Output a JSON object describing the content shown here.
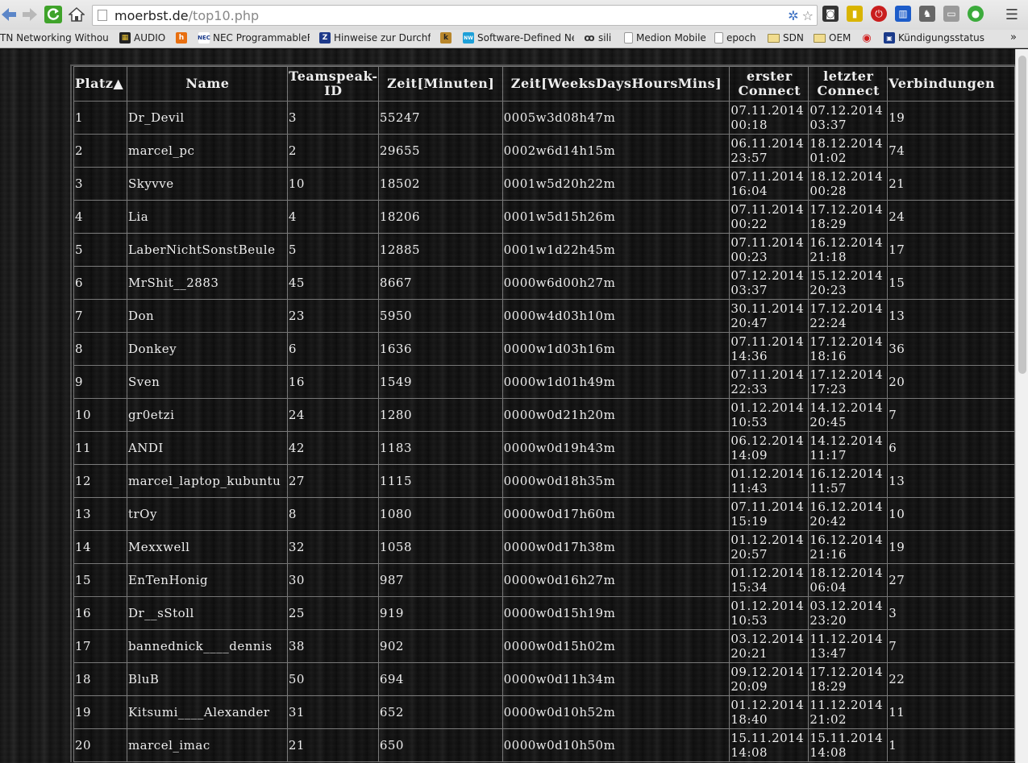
{
  "browser": {
    "url_host": "moerbst.de",
    "url_path": "/top10.php",
    "bookmarks": [
      {
        "label": "TN Networking Without",
        "icon": ""
      },
      {
        "label": "AUDIO",
        "icon": "grid-icon"
      },
      {
        "label": "",
        "icon": "h-icon"
      },
      {
        "label": "NEC ProgrammableFl",
        "icon": "nec-icon"
      },
      {
        "label": "Hinweise zur Durchfü",
        "icon": "z-icon"
      },
      {
        "label": "",
        "icon": "k-icon"
      },
      {
        "label": "Software-Defined Ne",
        "icon": "nw-icon"
      },
      {
        "label": "sili",
        "icon": "link-icon"
      },
      {
        "label": "Medion Mobile",
        "icon": "page-icon"
      },
      {
        "label": "epoch",
        "icon": "page-icon"
      },
      {
        "label": "SDN",
        "icon": "folder-icon"
      },
      {
        "label": "OEM",
        "icon": "folder-icon"
      },
      {
        "label": "",
        "icon": "circle-icon"
      },
      {
        "label": "Kündigungsstatus",
        "icon": "box-icon"
      }
    ],
    "more": "»"
  },
  "table": {
    "headers": {
      "platz": "Platz▲",
      "name": "Name",
      "ts_id_1": "Teamspeak-",
      "ts_id_2": "ID",
      "zeit_min": "Zeit[Minuten]",
      "zeit_wdhm": "Zeit[WeeksDaysHoursMins]",
      "erster_1": "erster",
      "erster_2": "Connect",
      "letzter_1": "letzter",
      "letzter_2": "Connect",
      "verbindungen": "Verbindungen"
    },
    "rows": [
      {
        "platz": "1",
        "name": "Dr_Devil",
        "id": "3",
        "minuten": "55247",
        "wdhm": "0005w3d08h47m",
        "erster_d": "07.11.2014",
        "erster_t": "00:18",
        "letzter_d": "07.12.2014",
        "letzter_t": "03:37",
        "verb": "19"
      },
      {
        "platz": "2",
        "name": "marcel_pc",
        "id": "2",
        "minuten": "29655",
        "wdhm": "0002w6d14h15m",
        "erster_d": "06.11.2014",
        "erster_t": "23:57",
        "letzter_d": "18.12.2014",
        "letzter_t": "01:02",
        "verb": "74"
      },
      {
        "platz": "3",
        "name": "Skyvve",
        "id": "10",
        "minuten": "18502",
        "wdhm": "0001w5d20h22m",
        "erster_d": "07.11.2014",
        "erster_t": "16:04",
        "letzter_d": "18.12.2014",
        "letzter_t": "00:28",
        "verb": "21"
      },
      {
        "platz": "4",
        "name": "Lia",
        "id": "4",
        "minuten": "18206",
        "wdhm": "0001w5d15h26m",
        "erster_d": "07.11.2014",
        "erster_t": "00:22",
        "letzter_d": "17.12.2014",
        "letzter_t": "18:29",
        "verb": "24"
      },
      {
        "platz": "5",
        "name": "LaberNichtSonstBeule",
        "id": "5",
        "minuten": "12885",
        "wdhm": "0001w1d22h45m",
        "erster_d": "07.11.2014",
        "erster_t": "00:23",
        "letzter_d": "16.12.2014",
        "letzter_t": "21:18",
        "verb": "17"
      },
      {
        "platz": "6",
        "name": "MrShit__2883",
        "id": "45",
        "minuten": "8667",
        "wdhm": "0000w6d00h27m",
        "erster_d": "07.12.2014",
        "erster_t": "03:37",
        "letzter_d": "15.12.2014",
        "letzter_t": "20:23",
        "verb": "15"
      },
      {
        "platz": "7",
        "name": "Don",
        "id": "23",
        "minuten": "5950",
        "wdhm": "0000w4d03h10m",
        "erster_d": "30.11.2014",
        "erster_t": "20:47",
        "letzter_d": "17.12.2014",
        "letzter_t": "22:24",
        "verb": "13"
      },
      {
        "platz": "8",
        "name": "Donkey",
        "id": "6",
        "minuten": "1636",
        "wdhm": "0000w1d03h16m",
        "erster_d": "07.11.2014",
        "erster_t": "14:36",
        "letzter_d": "17.12.2014",
        "letzter_t": "18:16",
        "verb": "36"
      },
      {
        "platz": "9",
        "name": "Sven",
        "id": "16",
        "minuten": "1549",
        "wdhm": "0000w1d01h49m",
        "erster_d": "07.11.2014",
        "erster_t": "22:33",
        "letzter_d": "17.12.2014",
        "letzter_t": "17:23",
        "verb": "20"
      },
      {
        "platz": "10",
        "name": "gr0etzi",
        "id": "24",
        "minuten": "1280",
        "wdhm": "0000w0d21h20m",
        "erster_d": "01.12.2014",
        "erster_t": "10:53",
        "letzter_d": "14.12.2014",
        "letzter_t": "20:45",
        "verb": "7"
      },
      {
        "platz": "11",
        "name": "ANDI",
        "id": "42",
        "minuten": "1183",
        "wdhm": "0000w0d19h43m",
        "erster_d": "06.12.2014",
        "erster_t": "14:09",
        "letzter_d": "14.12.2014",
        "letzter_t": "11:17",
        "verb": "6"
      },
      {
        "platz": "12",
        "name": "marcel_laptop_kubuntu",
        "id": "27",
        "minuten": "1115",
        "wdhm": "0000w0d18h35m",
        "erster_d": "01.12.2014",
        "erster_t": "11:43",
        "letzter_d": "16.12.2014",
        "letzter_t": "11:57",
        "verb": "13"
      },
      {
        "platz": "13",
        "name": "trOy",
        "id": "8",
        "minuten": "1080",
        "wdhm": "0000w0d17h60m",
        "erster_d": "07.11.2014",
        "erster_t": "15:19",
        "letzter_d": "16.12.2014",
        "letzter_t": "20:42",
        "verb": "10"
      },
      {
        "platz": "14",
        "name": "Mexxwell",
        "id": "32",
        "minuten": "1058",
        "wdhm": "0000w0d17h38m",
        "erster_d": "01.12.2014",
        "erster_t": "20:57",
        "letzter_d": "16.12.2014",
        "letzter_t": "21:16",
        "verb": "19"
      },
      {
        "platz": "15",
        "name": "EnTenHonig",
        "id": "30",
        "minuten": "987",
        "wdhm": "0000w0d16h27m",
        "erster_d": "01.12.2014",
        "erster_t": "15:34",
        "letzter_d": "18.12.2014",
        "letzter_t": "06:04",
        "verb": "27"
      },
      {
        "platz": "16",
        "name": "Dr__sStoll",
        "id": "25",
        "minuten": "919",
        "wdhm": "0000w0d15h19m",
        "erster_d": "01.12.2014",
        "erster_t": "10:53",
        "letzter_d": "03.12.2014",
        "letzter_t": "23:20",
        "verb": "3"
      },
      {
        "platz": "17",
        "name": "bannednick____dennis",
        "id": "38",
        "minuten": "902",
        "wdhm": "0000w0d15h02m",
        "erster_d": "03.12.2014",
        "erster_t": "20:21",
        "letzter_d": "11.12.2014",
        "letzter_t": "13:47",
        "verb": "7"
      },
      {
        "platz": "18",
        "name": "BluB",
        "id": "50",
        "minuten": "694",
        "wdhm": "0000w0d11h34m",
        "erster_d": "09.12.2014",
        "erster_t": "20:09",
        "letzter_d": "17.12.2014",
        "letzter_t": "18:29",
        "verb": "22"
      },
      {
        "platz": "19",
        "name": "Kitsumi____Alexander",
        "id": "31",
        "minuten": "652",
        "wdhm": "0000w0d10h52m",
        "erster_d": "01.12.2014",
        "erster_t": "18:40",
        "letzter_d": "11.12.2014",
        "letzter_t": "21:02",
        "verb": "11"
      },
      {
        "platz": "20",
        "name": "marcel_imac",
        "id": "21",
        "minuten": "650",
        "wdhm": "0000w0d10h50m",
        "erster_d": "15.11.2014",
        "erster_t": "14:08",
        "letzter_d": "15.11.2014",
        "letzter_t": "14:08",
        "verb": "1"
      }
    ]
  }
}
